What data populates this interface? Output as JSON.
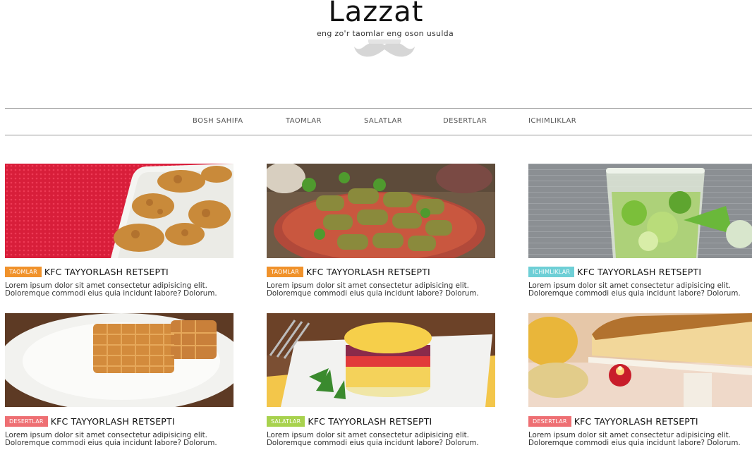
{
  "brand": {
    "title": "Lazzat",
    "tagline": "eng zo'r taomlar eng oson usulda"
  },
  "nav": {
    "items": [
      {
        "label": "BOSH SAHIFA"
      },
      {
        "label": "TAOMLAR"
      },
      {
        "label": "SALATLAR"
      },
      {
        "label": "DESERTLAR"
      },
      {
        "label": "ICHIMLIKLAR"
      }
    ]
  },
  "cards": [
    {
      "category": "TAOMLAR",
      "category_color": "#f0922b",
      "title": "KFC TAYYORLASH RETSEPTI",
      "image": "fried-chicken-image",
      "line1": "Lorem ipsum dolor sit amet consectetur adipisicing elit.",
      "line2": "Doloremque commodi eius quia incidunt labore? Dolorum."
    },
    {
      "category": "TAOMLAR",
      "category_color": "#f0922b",
      "title": "KFC TAYYORLASH RETSEPTI",
      "image": "dolma-image",
      "line1": "Lorem ipsum dolor sit amet consectetur adipisicing elit.",
      "line2": "Doloremque commodi eius quia incidunt labore? Dolorum."
    },
    {
      "category": "ICHIMLIKLAR",
      "category_color": "#6ecfd6",
      "title": "KFC TAYYORLASH RETSEPTI",
      "image": "mojito-drink-image",
      "line1": "Lorem ipsum dolor sit amet consectetur adipisicing elit.",
      "line2": "Doloremque commodi eius quia incidunt labore? Dolorum."
    },
    {
      "category": "DESERTLAR",
      "category_color": "#ee6f73",
      "title": "KFC TAYYORLASH RETSEPTI",
      "image": "waffles-image",
      "line1": "Lorem ipsum dolor sit amet consectetur adipisicing elit.",
      "line2": "Doloremque commodi eius quia incidunt labore? Dolorum."
    },
    {
      "category": "SALATLAR",
      "category_color": "#a8d24e",
      "title": "KFC TAYYORLASH RETSEPTI",
      "image": "layered-salad-image",
      "line1": "Lorem ipsum dolor sit amet consectetur adipisicing elit.",
      "line2": "Doloremque commodi eius quia incidunt labore? Dolorum."
    },
    {
      "category": "DESERTLAR",
      "category_color": "#ee6f73",
      "title": "KFC TAYYORLASH RETSEPTI",
      "image": "cheesecake-image",
      "line1": "Lorem ipsum dolor sit amet consectetur adipisicing elit.",
      "line2": "Doloremque commodi eius quia incidunt labore? Dolorum."
    }
  ]
}
